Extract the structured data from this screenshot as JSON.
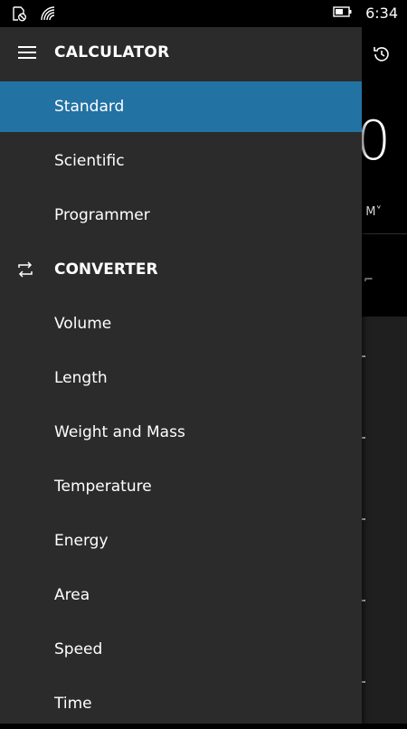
{
  "status_bar": {
    "time": "6:34",
    "icons": [
      "data-saver-icon",
      "wifi-icon",
      "battery-icon"
    ]
  },
  "drawer": {
    "title": "CALCULATOR",
    "calculator_items": [
      {
        "label": "Standard",
        "selected": true
      },
      {
        "label": "Scientific",
        "selected": false
      },
      {
        "label": "Programmer",
        "selected": false
      }
    ],
    "converter_title": "CONVERTER",
    "converter_items": [
      {
        "label": "Volume"
      },
      {
        "label": "Length"
      },
      {
        "label": "Weight and Mass"
      },
      {
        "label": "Temperature"
      },
      {
        "label": "Energy"
      },
      {
        "label": "Area"
      },
      {
        "label": "Speed"
      },
      {
        "label": "Time"
      }
    ]
  },
  "background_app": {
    "display_value": "0",
    "memory_label": "M˅",
    "icons": [
      "history-icon"
    ]
  },
  "colors": {
    "accent": "#2272a4",
    "drawer_bg": "#2b2b2b",
    "app_bg": "#000000"
  }
}
